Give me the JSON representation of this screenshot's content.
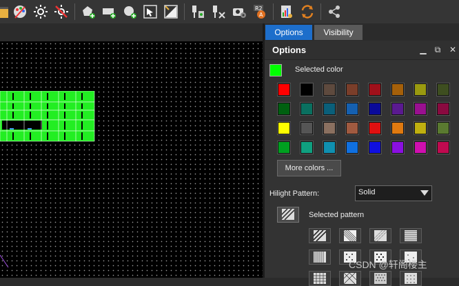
{
  "toolbar": {
    "icons": [
      "ruler-icon",
      "palette-icon",
      "sun-icon",
      "sun-off-icon",
      "polygon-add-icon",
      "rect-add-icon",
      "circle-add-icon",
      "select-cursor-icon",
      "fill-icon",
      "probe-icon",
      "probe-tools-icon",
      "camera-settings-icon",
      "r2-icon",
      "report-icon",
      "sync-icon",
      "share-icon"
    ],
    "r2_badge": "R2",
    "r2_sub": "A"
  },
  "tabs": {
    "options": "Options",
    "visibility": "Visibility"
  },
  "panel": {
    "title": "Options",
    "selected_color_label": "Selected color",
    "selected_color": "#00ff00",
    "more_colors": "More colors ...",
    "hilight_pattern_label": "Hilight Pattern:",
    "hilight_pattern_value": "Solid",
    "selected_pattern_label": "Selected pattern"
  },
  "palette": [
    [
      "#ff0000",
      "#000000",
      "#5e4a3e",
      "#7a3e2a",
      "#a0101a",
      "#a5600a",
      "#9a9a10",
      "#3e4e20"
    ],
    [
      "#006010",
      "#0a7060",
      "#0a5f7a",
      "#1560b0",
      "#0a0a9a",
      "#5a1a90",
      "#9a1090",
      "#8a0a40"
    ],
    [
      "#ffff00",
      "#555555",
      "#8a7060",
      "#a05a40",
      "#e01010",
      "#e07a10",
      "#c0b010",
      "#5a7a30"
    ],
    [
      "#00a020",
      "#10a080",
      "#1090b0",
      "#1070e0",
      "#1010e0",
      "#8a10e0",
      "#d010b0",
      "#c00a50"
    ]
  ],
  "patterns": [
    [
      "diag-hatch-pattern",
      "fine-diag-pattern",
      "dotted-diag-pattern",
      "horizontal-lines-pattern"
    ],
    [
      "vertical-lines-pattern",
      "dots-pattern",
      "checker-dots-pattern",
      "sparse-dots-pattern"
    ],
    [
      "cross-hatch-pattern",
      "diamond-pattern",
      "dense-dots-pattern",
      "grid-dots-pattern"
    ]
  ],
  "layout": {
    "top_labels": [
      "Y",
      "Y",
      "Y",
      "Y",
      "Y"
    ],
    "mid_labels": [
      "H",
      "H"
    ]
  },
  "watermark": "CSDN @轩阁楼主"
}
